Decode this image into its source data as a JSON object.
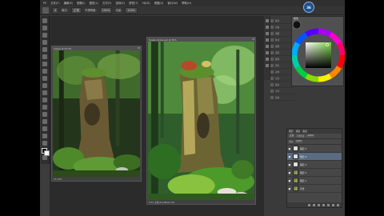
{
  "menubar": {
    "items": [
      "PS",
      "文件(F)",
      "编辑(E)",
      "图像(I)",
      "图层(L)",
      "文字(Y)",
      "选择(S)",
      "滤镜(T)",
      "3D(D)",
      "视图(V)",
      "窗口(W)",
      "帮助(H)"
    ]
  },
  "options": {
    "size_value": "4",
    "mode_label": "模式:",
    "mode_value": "正常",
    "opacity_label": "不透明度:",
    "opacity_value": "100%",
    "flow_label": "流量:",
    "flow_value": "100%"
  },
  "badge": {
    "text": "36"
  },
  "documents": [
    {
      "title": "ref.jpg @ 33.3%",
      "status": "33.33%"
    },
    {
      "title": "forest_shrine.psd @ 50%",
      "status": "50% 文档:8.24M/62.1M"
    }
  ],
  "color_panel": {
    "title": "颜色"
  },
  "nav_items": [
    "颜色",
    "色板",
    "调整",
    "样式",
    "画笔",
    "通道",
    "路径",
    "历史",
    "动作",
    "信息",
    "属性",
    "字符",
    "段落"
  ],
  "layers_panel": {
    "tabs": [
      "图层",
      "通道",
      "路径"
    ],
    "blend_mode": "正常",
    "opacity_label": "不透明度:",
    "opacity_value": "100%",
    "fill_label": "填充:",
    "fill_value": "100%",
    "rows": [
      {
        "name": "图层 5",
        "visible": "●",
        "thumb": "blank"
      },
      {
        "name": "图层 4",
        "visible": "●",
        "thumb": "blank"
      },
      {
        "name": "图层 3",
        "visible": "●",
        "thumb": "blank"
      },
      {
        "name": "图层 2",
        "visible": "●",
        "thumb": "img"
      },
      {
        "name": "图层 1",
        "visible": "●",
        "thumb": "img"
      },
      {
        "name": "背景",
        "visible": "●",
        "thumb": "img"
      }
    ],
    "active_index": 1
  }
}
